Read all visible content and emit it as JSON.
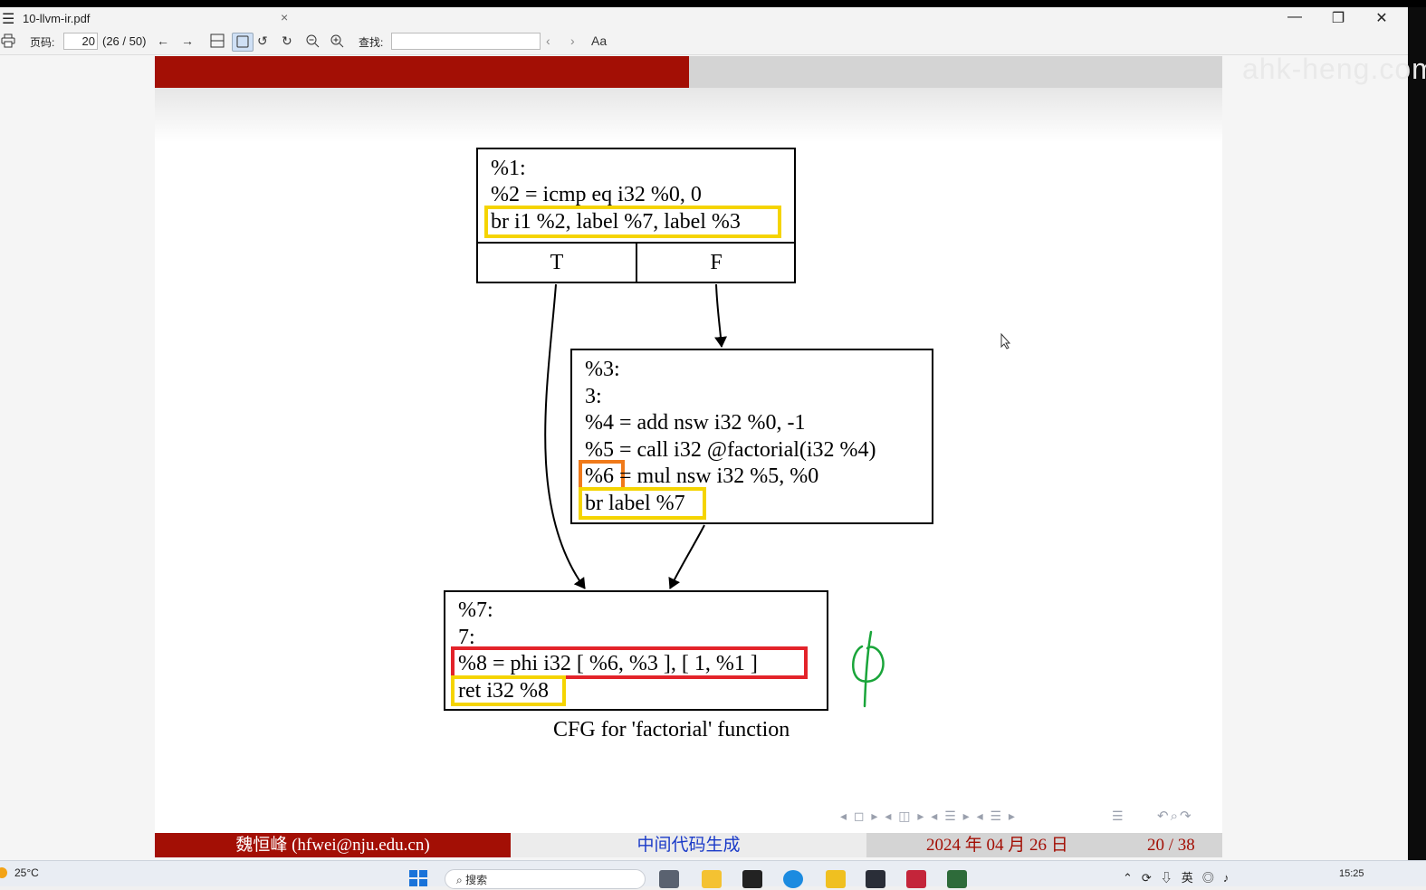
{
  "window": {
    "menu_glyph": "☰",
    "title": "10-llvm-ir.pdf",
    "tab_close": "×",
    "minimize": "—",
    "restore": "❐",
    "close": "✕"
  },
  "toolbar": {
    "page_label": "页码:",
    "page_value": "20",
    "page_info": "(26 / 50)",
    "search_label": "查找:",
    "search_value": "",
    "font_button": "Aa"
  },
  "slide": {
    "cfg": {
      "block1": [
        "%1:",
        "%2 = icmp eq i32 %0, 0",
        "br i1 %2, label %7, label %3"
      ],
      "branch_true": "T",
      "branch_false": "F",
      "block3": [
        "%3:",
        "3:",
        "%4 = add nsw i32 %0, -1",
        "%5 = call i32 @factorial(i32 %4)",
        "%6 = mul nsw i32 %5, %0",
        "br label %7"
      ],
      "block7": [
        "%7:",
        "7:",
        "%8 = phi i32 [ %6, %3 ], [ 1, %1 ]",
        "ret i32 %8"
      ],
      "highlight_yellow": "#f5d400",
      "highlight_orange": "#f07a1a",
      "highlight_red": "#e3232a",
      "annotation_color": "#1aa53a"
    },
    "caption": "CFG for 'factorial' function",
    "footer": {
      "author": "魏恒峰 (hfwei@nju.edu.cn)",
      "topic": "中间代码生成",
      "date": "2024 年 04 月 26 日",
      "page": "20 / 38"
    },
    "watermark": "ahk-heng.com",
    "theme_red": "#a30f05"
  },
  "taskbar": {
    "temperature": "25°C",
    "search_placeholder": "搜索",
    "time": "15:25",
    "ime": "英"
  }
}
